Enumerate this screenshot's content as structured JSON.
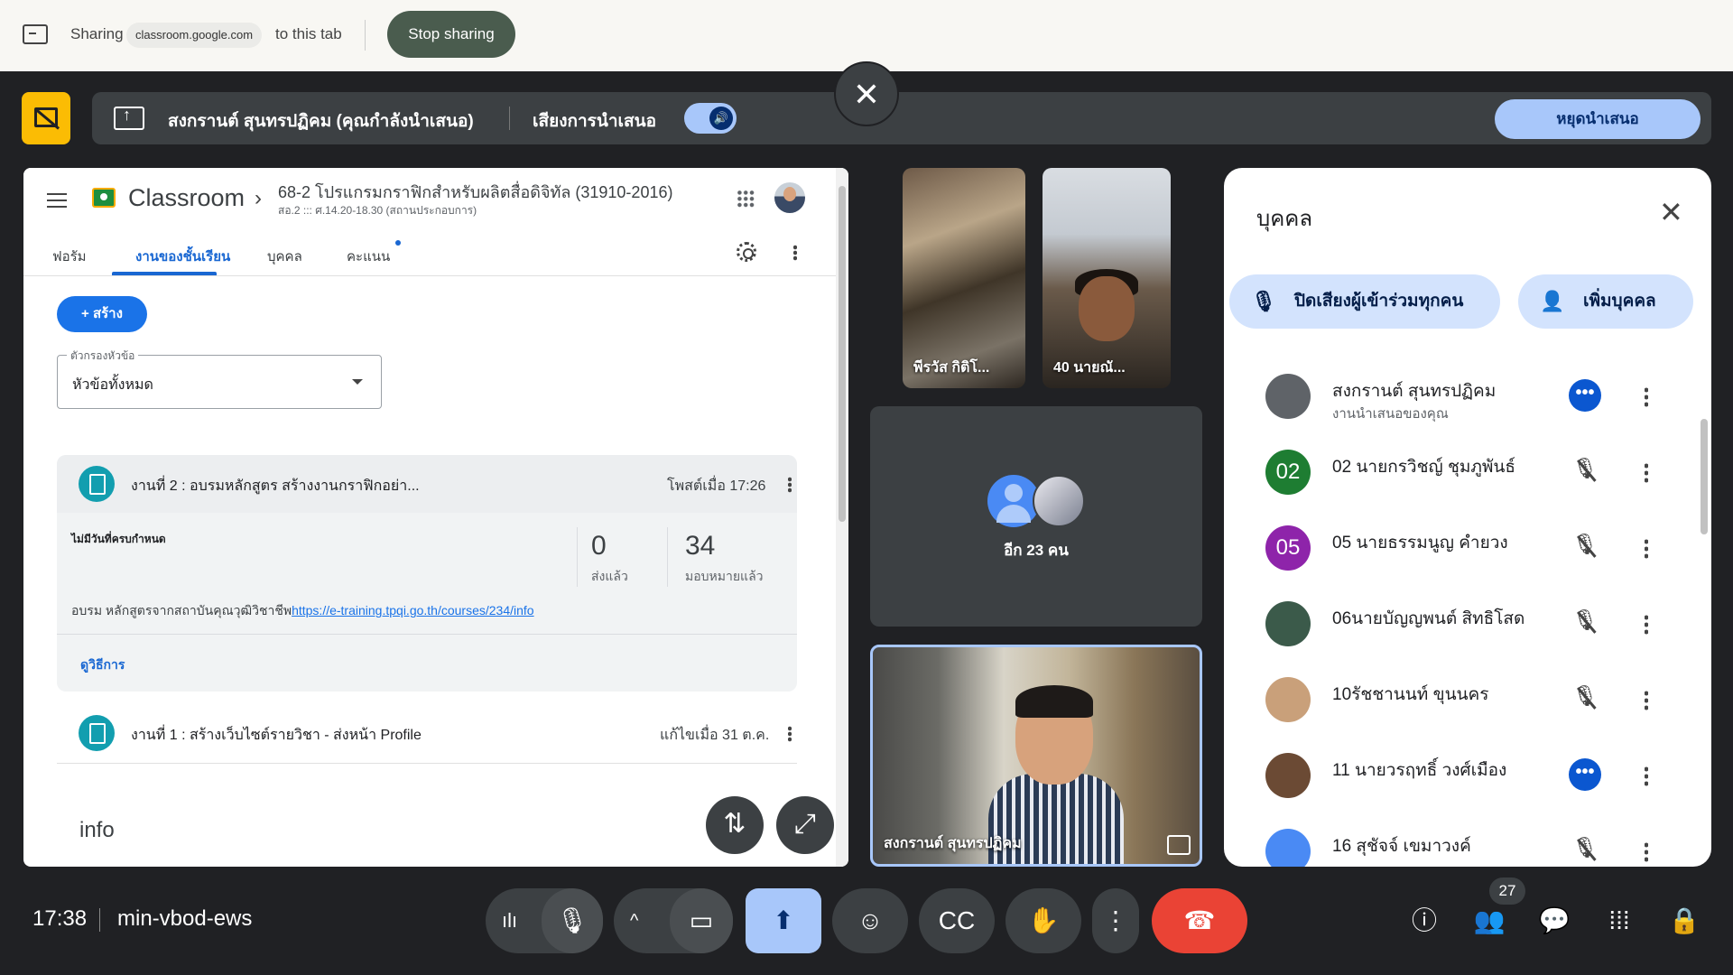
{
  "sharebar": {
    "sharing_label": "Sharing",
    "domain": "classroom.google.com",
    "to_tab": "to this tab",
    "stop_sharing": "Stop sharing"
  },
  "present": {
    "presenter_label": "สงกรานต์ สุนทรปฏิคม (คุณกำลังนำเสนอ)",
    "audio_label": "เสียงการนำเสนอ",
    "audio_on": true,
    "stop_label": "หยุดนำเสนอ",
    "close_icon": "close-icon"
  },
  "classroom": {
    "app_name": "Classroom",
    "course_title": "68-2 โปรแกรมกราฟิกสำหรับผลิตสื่อดิจิทัล (31910-2016)",
    "course_sub": "สอ.2 ::: ศ.14.20-18.30 (สถานประกอบการ)",
    "tabs": [
      "ฟอรัม",
      "งานของชั้นเรียน",
      "บุคคล",
      "คะแนน"
    ],
    "active_tab": "งานของชั้นเรียน",
    "create_label": "+  สร้าง",
    "filter_label": "ตัวกรองหัวข้อ",
    "filter_value": "หัวข้อทั้งหมด",
    "assignment1": {
      "title": "งานที่ 2 : อบรมหลักสูตร สร้างงานกราฟิกอย่า...",
      "posted": "โพสต์เมื่อ 17:26",
      "due": "ไม่มีวันที่ครบกำหนด",
      "turned_in_count": "0",
      "turned_in_label": "ส่งแล้ว",
      "assigned_count": "34",
      "assigned_label": "มอบหมายแล้ว",
      "desc_prefix": "อบรม หลักสูตรจากสถาบันคุณวุฒิวิชาชีพ",
      "link": "https://e-training.tpqi.go.th/courses/234/info",
      "view_label": "ดูวิธีการ"
    },
    "assignment2": {
      "title": "งานที่ 1 : สร้างเว็บไซต์รายวิชา - ส่งหน้า Profile",
      "edited": "แก้ไขเมื่อ 31 ต.ค."
    },
    "section_title": "info"
  },
  "videos": {
    "tileA_name": "พีรวัส กิติโ...",
    "tileB_name": "40 นายณั...",
    "more_label": "อีก 23 คน",
    "self_name": "สงกรานต์ สุนทรปฏิคม"
  },
  "people": {
    "title": "บุคคล",
    "mute_all": "ปิดเสียงผู้เข้าร่วมทุกคน",
    "add_people": "เพิ่มบุคคล",
    "list": [
      {
        "name": "สงกรานต์ สุนทรปฏิคม",
        "sub": "งานนำเสนอของคุณ",
        "avatar_text": "",
        "color": "#5f6368",
        "status": "speaking"
      },
      {
        "name": "02 นายกรวิชญ์ ชุมภูพันธ์",
        "sub": "",
        "avatar_text": "02",
        "color": "#1e7d32",
        "status": "muted"
      },
      {
        "name": "05 นายธรรมนูญ คำยวง",
        "sub": "",
        "avatar_text": "05",
        "color": "#8e24aa",
        "status": "muted"
      },
      {
        "name": "06นายบัญญพนต์ สิทธิโสด",
        "sub": "",
        "avatar_text": "",
        "color": "#3b5a4a",
        "status": "muted"
      },
      {
        "name": "10รัชชานนท์ ขุนนคร",
        "sub": "",
        "avatar_text": "",
        "color": "#c9a07a",
        "status": "muted"
      },
      {
        "name": "11 นายวรฤทธิ์ วงศ์เมือง",
        "sub": "",
        "avatar_text": "",
        "color": "#6b4a34",
        "status": "speaking"
      },
      {
        "name": "16 สุชัจจ์ เขมาวงค์",
        "sub": "",
        "avatar_text": "",
        "color": "#4a8af4",
        "status": "muted"
      }
    ]
  },
  "bottom": {
    "time": "17:38",
    "meeting_code": "min-vbod-ews",
    "participants_count": "27",
    "colors": {
      "accent": "#a8c7fa",
      "end_call": "#ea4335",
      "control_bg": "#3c4043"
    }
  }
}
